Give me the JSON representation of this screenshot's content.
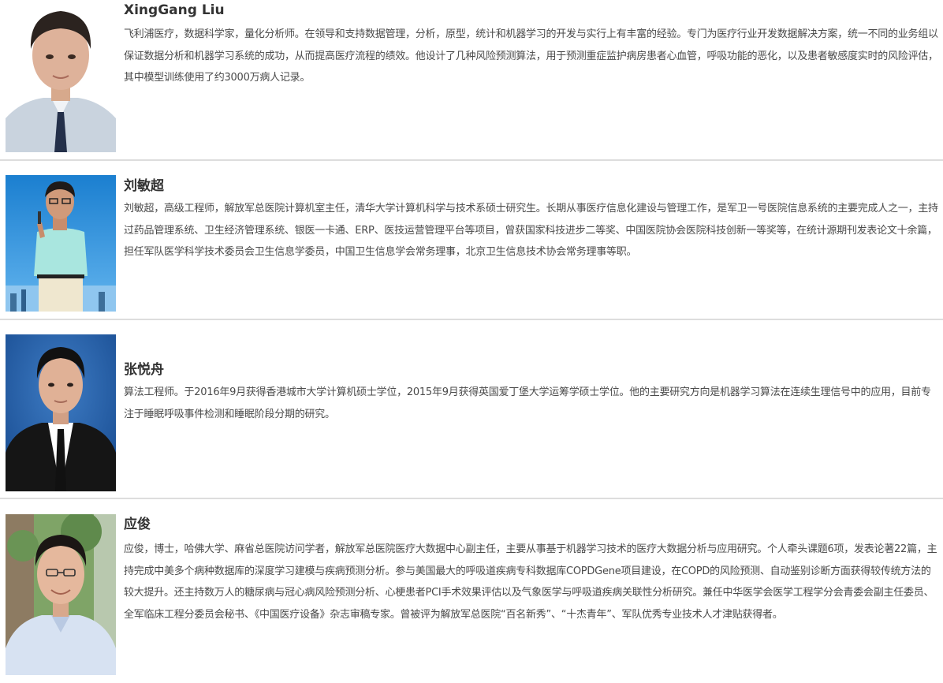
{
  "profiles": [
    {
      "name": "XingGang  Liu",
      "bio": "飞利浦医疗，数据科学家，量化分析师。在领导和支持数据管理，分析，原型，统计和机器学习的开发与实行上有丰富的经验。专门为医疗行业开发数据解决方案，统一不同的业务组以保证数据分析和机器学习系统的成功，从而提高医疗流程的绩效。他设计了几种风险预测算法，用于预测重症监护病房患者心血管，呼吸功能的恶化，以及患者敏感度实时的风险评估，其中模型训练使用了约3000万病人记录。"
    },
    {
      "name": "刘敏超",
      "bio": "刘敏超，高级工程师，解放军总医院计算机室主任，清华大学计算机科学与技术系硕士研究生。长期从事医疗信息化建设与管理工作，是军卫一号医院信息系统的主要完成人之一，主持过药品管理系统、卫生经济管理系统、银医一卡通、ERP、医技运营管理平台等项目，曾获国家科技进步二等奖、中国医院协会医院科技创新一等奖等，在统计源期刊发表论文十余篇，担任军队医学科学技术委员会卫生信息学委员，中国卫生信息学会常务理事，北京卫生信息技术协会常务理事等职。"
    },
    {
      "name": "张悦舟",
      "bio": "算法工程师。于2016年9月获得香港城市大学计算机硕士学位，2015年9月获得英国爱丁堡大学运筹学硕士学位。他的主要研究方向是机器学习算法在连续生理信号中的应用，目前专注于睡眠呼吸事件检测和睡眠阶段分期的研究。"
    },
    {
      "name": "应俊",
      "bio": "应俊，博士，哈佛大学、麻省总医院访问学者，解放军总医院医疗大数据中心副主任，主要从事基于机器学习技术的医疗大数据分析与应用研究。个人牵头课题6项，发表论著22篇，主持完成中美多个病种数据库的深度学习建模与疾病预测分析。参与美国最大的呼吸道疾病专科数据库COPDGene项目建设，在COPD的风险预测、自动鉴别诊断方面获得较传统方法的较大提升。还主持数万人的糖尿病与冠心病风险预测分析、心梗患者PCI手术效果评估以及气象医学与呼吸道疾病关联性分析研究。兼任中华医学会医学工程学分会青委会副主任委员、全军临床工程分委员会秘书、《中国医疗设备》杂志审稿专家。曾被评为解放军总医院“百名新秀”、“十杰青年”、军队优秀专业技术人才津贴获得者。"
    }
  ]
}
